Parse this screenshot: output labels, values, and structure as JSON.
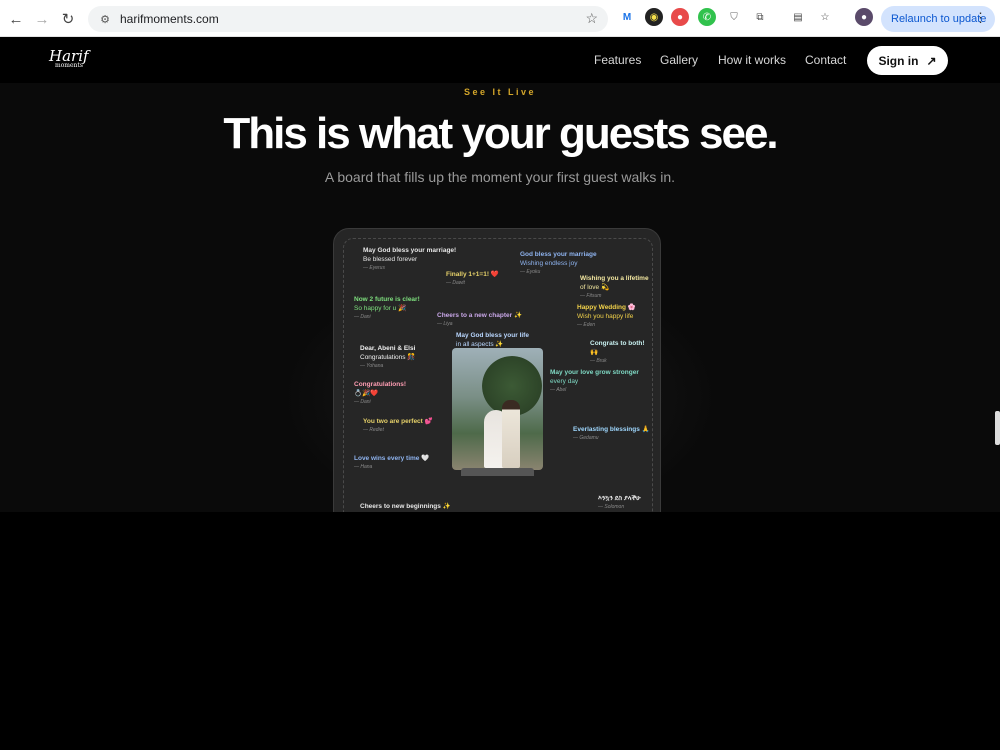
{
  "browser": {
    "url": "harifmoments.com",
    "relaunch_label": "Relaunch to update",
    "back_icon": "arrow-left-icon",
    "forward_icon": "arrow-right-icon",
    "reload_icon": "reload-icon"
  },
  "site": {
    "logo_text": "Harif",
    "logo_sub": "moments",
    "nav": {
      "features": "Features",
      "gallery": "Gallery",
      "how": "How it works",
      "contact": "Contact",
      "signin": "Sign in"
    },
    "eyebrow": "See It Live",
    "headline": "This is what your guests see.",
    "subheadline": "A board that fills up the moment your first guest walks in."
  },
  "board": {
    "messages": [
      {
        "l1": "May God bless your marriage!",
        "l2": "Be blessed forever",
        "from": "— Eyerus",
        "color": "#e7e7e7"
      },
      {
        "l1": "Finally 1+1=1! ❤️",
        "l2": "",
        "from": "— Dawit",
        "color": "#e8d36a"
      },
      {
        "l1": "God bless your marriage",
        "l2": "Wishing endless joy",
        "from": "— Eyoku",
        "color": "#8fb4f0"
      },
      {
        "l1": "Wishing you a lifetime",
        "l2": "of love 💫",
        "from": "— Fitsum",
        "color": "#f3e7a0"
      },
      {
        "l1": "Now 2 future is clear!",
        "l2": "So happy for u 🎉",
        "from": "— Dani",
        "color": "#7ee07e"
      },
      {
        "l1": "Cheers to a new chapter ✨",
        "l2": "",
        "from": "— Liya",
        "color": "#c9a7e8"
      },
      {
        "l1": "Happy Wedding 🌸",
        "l2": "Wish you happy life",
        "from": "— Eden",
        "color": "#f2d24a"
      },
      {
        "l1": "May God bless your life",
        "l2": "in all aspects ✨",
        "from": "— Eyuel",
        "color": "#b9d7ff"
      },
      {
        "l1": "Dear, Abeni & Elsi",
        "l2": "Congratulations 🎊",
        "from": "— Yohana",
        "color": "#f0f0f0"
      },
      {
        "l1": "Congrats to both!",
        "l2": "🙌",
        "from": "— Bruk",
        "color": "#c8f0f0"
      },
      {
        "l1": "May your love grow stronger",
        "l2": "every day",
        "from": "— Abel",
        "color": "#7fd9c4"
      },
      {
        "l1": "Congratulations!",
        "l2": "💍🎉❤️",
        "from": "— Dani",
        "color": "#ff9db3"
      },
      {
        "l1": "You two are perfect 💕",
        "l2": "",
        "from": "— Rediet",
        "color": "#e8d36a"
      },
      {
        "l1": "Everlasting blessings 🙏",
        "l2": "",
        "from": "— Gedamu",
        "color": "#9fd8ff"
      },
      {
        "l1": "Love wins every time 🤍",
        "l2": "",
        "from": "— Hana",
        "color": "#8fb4f0"
      },
      {
        "l1": "Cheers to new beginnings ✨",
        "l2": "",
        "from": "",
        "color": "#e7e7e7"
      },
      {
        "l1": "እንኳን ደስ ያላችሁ",
        "l2": "",
        "from": "— Solomon",
        "color": "#e7e7e7"
      }
    ]
  }
}
